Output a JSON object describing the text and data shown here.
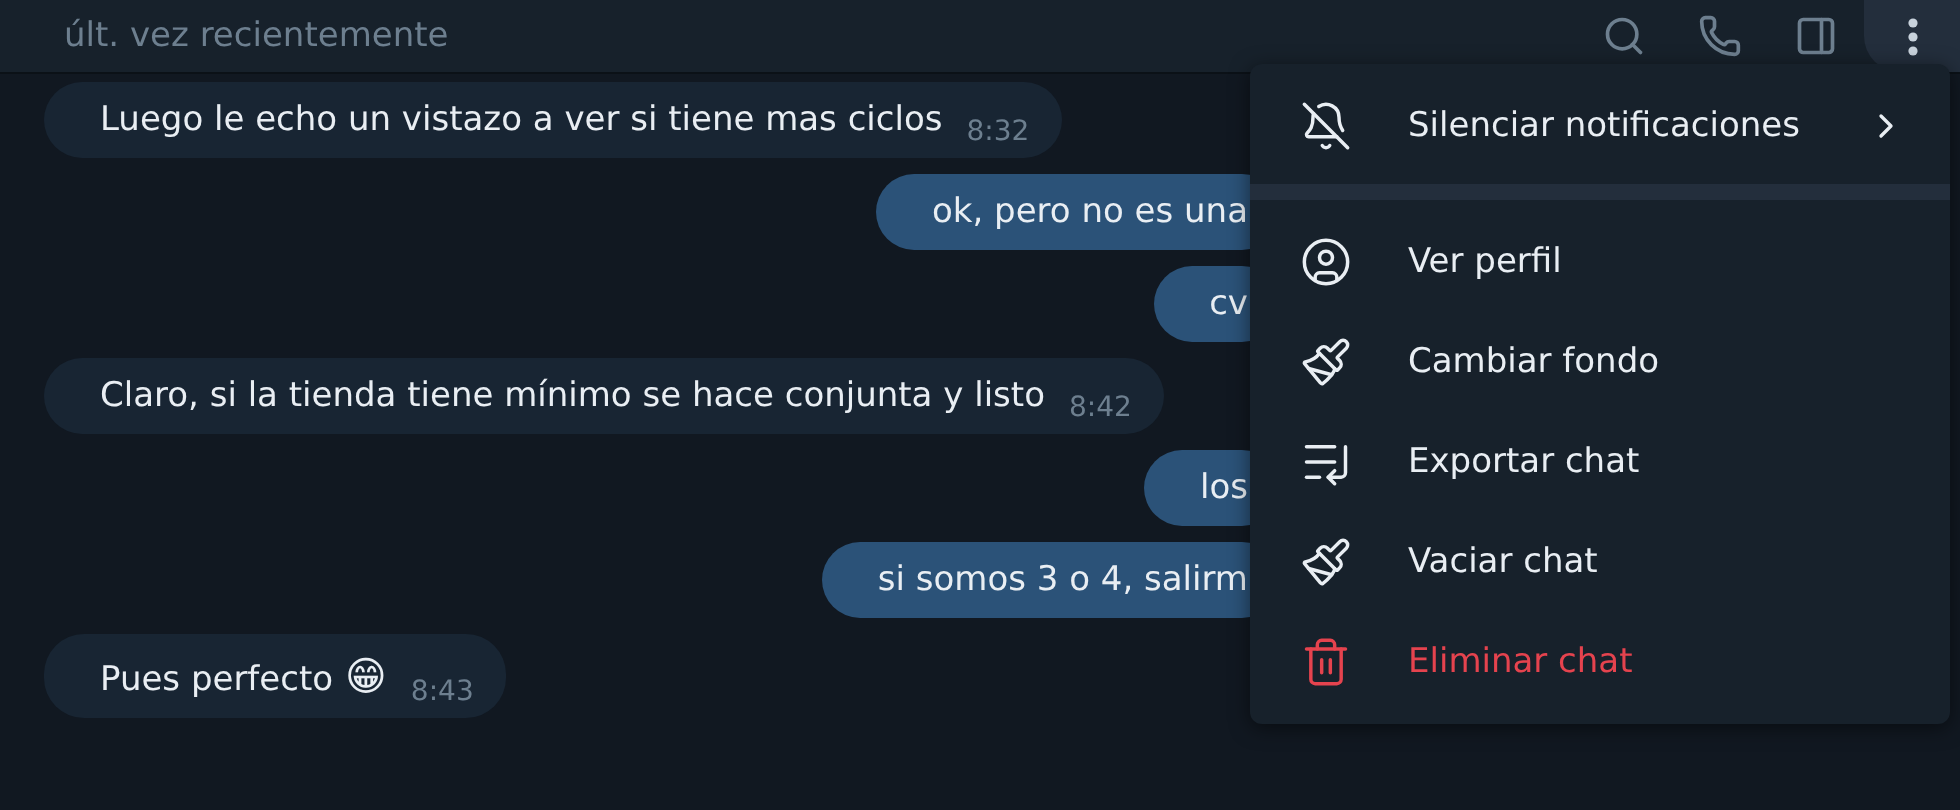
{
  "header": {
    "status": "últ. vez recientemente"
  },
  "messages": [
    {
      "kind": "in",
      "text": "Luego le echo un vistazo a ver si tiene mas ciclos",
      "time": "8:32"
    },
    {
      "kind": "out",
      "text": "ok, pero no es una"
    },
    {
      "kind": "out",
      "text": "cv"
    },
    {
      "kind": "in",
      "text": "Claro, si la tienda tiene mínimo se hace conjunta y listo",
      "time": "8:42"
    },
    {
      "kind": "out",
      "text": "los"
    },
    {
      "kind": "out",
      "text": "si somos 3 o 4, salirm"
    },
    {
      "kind": "in",
      "text": "Pues perfecto",
      "emoji": "😁",
      "time": "8:43"
    }
  ],
  "menu": {
    "items": [
      {
        "kind": "mute",
        "label": "Silenciar notificaciones",
        "submenu": true,
        "danger": false
      },
      {
        "kind": "profile",
        "label": "Ver perfil",
        "submenu": false,
        "danger": false
      },
      {
        "kind": "wallpaper",
        "label": "Cambiar fondo",
        "submenu": false,
        "danger": false
      },
      {
        "kind": "export",
        "label": "Exportar chat",
        "submenu": false,
        "danger": false
      },
      {
        "kind": "clear",
        "label": "Vaciar chat",
        "submenu": false,
        "danger": false
      },
      {
        "kind": "delete",
        "label": "Eliminar chat",
        "submenu": false,
        "danger": true
      }
    ]
  }
}
